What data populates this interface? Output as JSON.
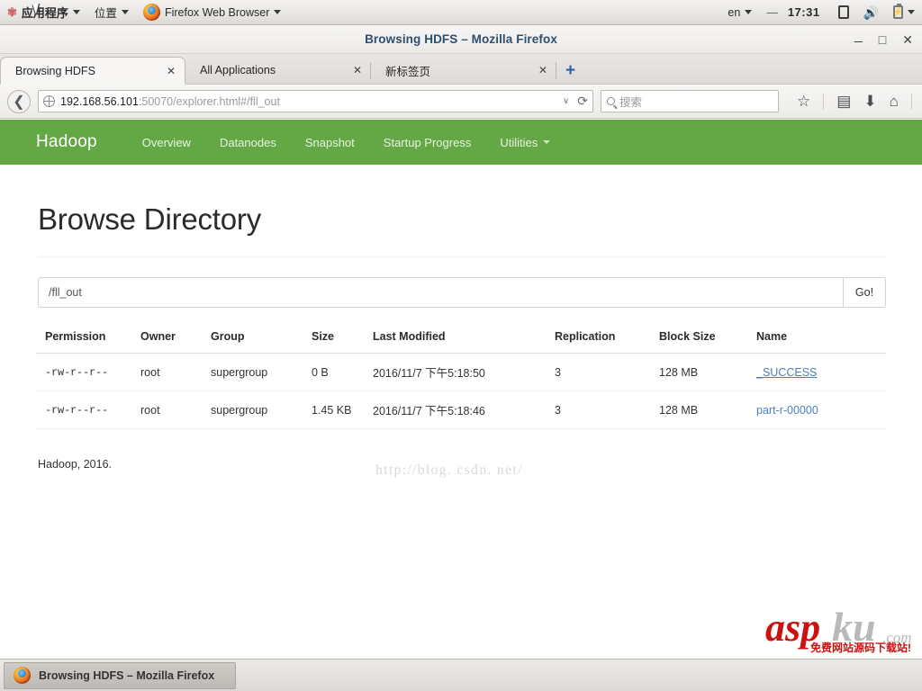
{
  "desktop_panel": {
    "applications_label": "应用程序",
    "places_label": "位置",
    "active_app_label": "Firefox Web Browser",
    "keyboard_layout": "en",
    "dash": "—",
    "clock": "17:31",
    "icons": [
      "display-icon",
      "volume-icon",
      "battery-icon",
      "chevron-down-icon"
    ]
  },
  "window": {
    "title": "Browsing HDFS – Mozilla Firefox",
    "minimize": "_",
    "maximize": "□",
    "close": "✕"
  },
  "tabs": [
    {
      "label": "Browsing HDFS",
      "close": "✕",
      "active": true
    },
    {
      "label": "All Applications",
      "close": "✕",
      "active": false
    },
    {
      "label": "新标签页",
      "close": "✕",
      "active": false
    }
  ],
  "new_tab_button": "+",
  "toolbar": {
    "back_arrow": "❮",
    "url_host": "192.168.56.101",
    "url_rest": ":50070/explorer.html#/fll_out",
    "url_full": "192.168.56.101:50070/explorer.html#/fll_out",
    "url_dropdown_caret": "∨",
    "reload": "⟳",
    "search_placeholder": "搜索",
    "search_value": "",
    "bookmark_star": "☆",
    "library": "▤",
    "downloads": "⬇",
    "home": "⌂"
  },
  "hadoop_nav": {
    "brand": "Hadoop",
    "links": [
      {
        "label": "Overview",
        "has_caret": false
      },
      {
        "label": "Datanodes",
        "has_caret": false
      },
      {
        "label": "Snapshot",
        "has_caret": false
      },
      {
        "label": "Startup Progress",
        "has_caret": false
      },
      {
        "label": "Utilities",
        "has_caret": true
      }
    ],
    "brand_color": "#63a844"
  },
  "main": {
    "page_title": "Browse Directory",
    "path_value": "/fll_out",
    "path_placeholder": "",
    "go_label": "Go!",
    "columns": [
      "Permission",
      "Owner",
      "Group",
      "Size",
      "Last Modified",
      "Replication",
      "Block Size",
      "Name"
    ],
    "rows": [
      {
        "permission": "-rw-r--r--",
        "owner": "root",
        "group": "supergroup",
        "size": "0 B",
        "last_modified": "2016/11/7 下午5:18:50",
        "replication": "3",
        "block_size": "128 MB",
        "name": "_SUCCESS"
      },
      {
        "permission": "-rw-r--r--",
        "owner": "root",
        "group": "supergroup",
        "size": "1.45 KB",
        "last_modified": "2016/11/7 下午5:18:46",
        "replication": "3",
        "block_size": "128 MB",
        "name": "part-r-00000"
      }
    ],
    "footer": "Hadoop, 2016."
  },
  "watermarks": {
    "csdn": "http://blog. csdn. net/",
    "aspku_asp": "asp",
    "aspku_ku": "ku",
    "aspku_com": ".com",
    "aspku_sub": "免费网站源码下载站!"
  },
  "taskbar": {
    "window_button": "Browsing HDFS – Mozilla Firefox"
  }
}
